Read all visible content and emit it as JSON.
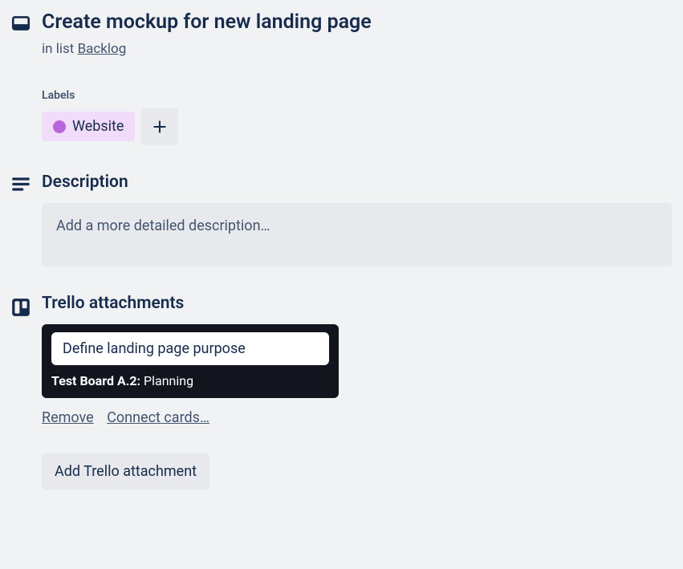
{
  "card": {
    "title": "Create mockup for new landing page",
    "in_list_prefix": "in list ",
    "list_name": "Backlog"
  },
  "labels": {
    "heading": "Labels",
    "items": [
      {
        "name": "Website",
        "color": "#b965db",
        "bg": "#f2dcfb"
      }
    ]
  },
  "description": {
    "heading": "Description",
    "placeholder": "Add a more detailed description…"
  },
  "trello": {
    "heading": "Trello attachments",
    "attachment": {
      "card_title": "Define landing page purpose",
      "board": "Test Board A.2:",
      "list": "Planning"
    },
    "remove_label": "Remove",
    "connect_label": "Connect cards…",
    "add_button": "Add Trello attachment"
  }
}
